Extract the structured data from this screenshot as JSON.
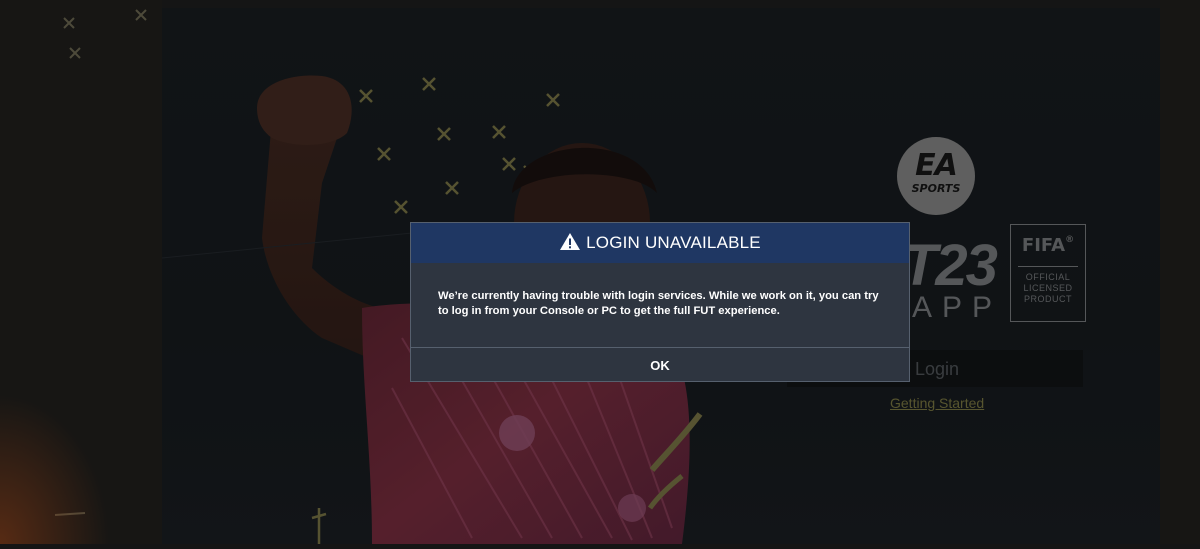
{
  "modal": {
    "title": "LOGIN UNAVAILABLE",
    "message": "We’re currently having trouble with login services. While we work on it, you can try to log in from your Console or PC to get the full FUT experience.",
    "ok_label": "OK",
    "icon": "warning-icon"
  },
  "brand": {
    "ea_logo_text": "EA",
    "ea_sports_text": "SPORTS",
    "app_number": "T23",
    "app_word": "APP",
    "fifa_text": "FIFA",
    "fifa_reg": "®",
    "fifa_license": [
      "OFFICIAL",
      "LICENSED",
      "PRODUCT"
    ]
  },
  "login": {
    "login_label": "Login",
    "getting_started_label": "Getting Started"
  },
  "colors": {
    "modal_header": "#1f3763",
    "modal_body": "#2e3540",
    "accent_link": "#8d8a4c",
    "backdrop": "#1c2125"
  }
}
